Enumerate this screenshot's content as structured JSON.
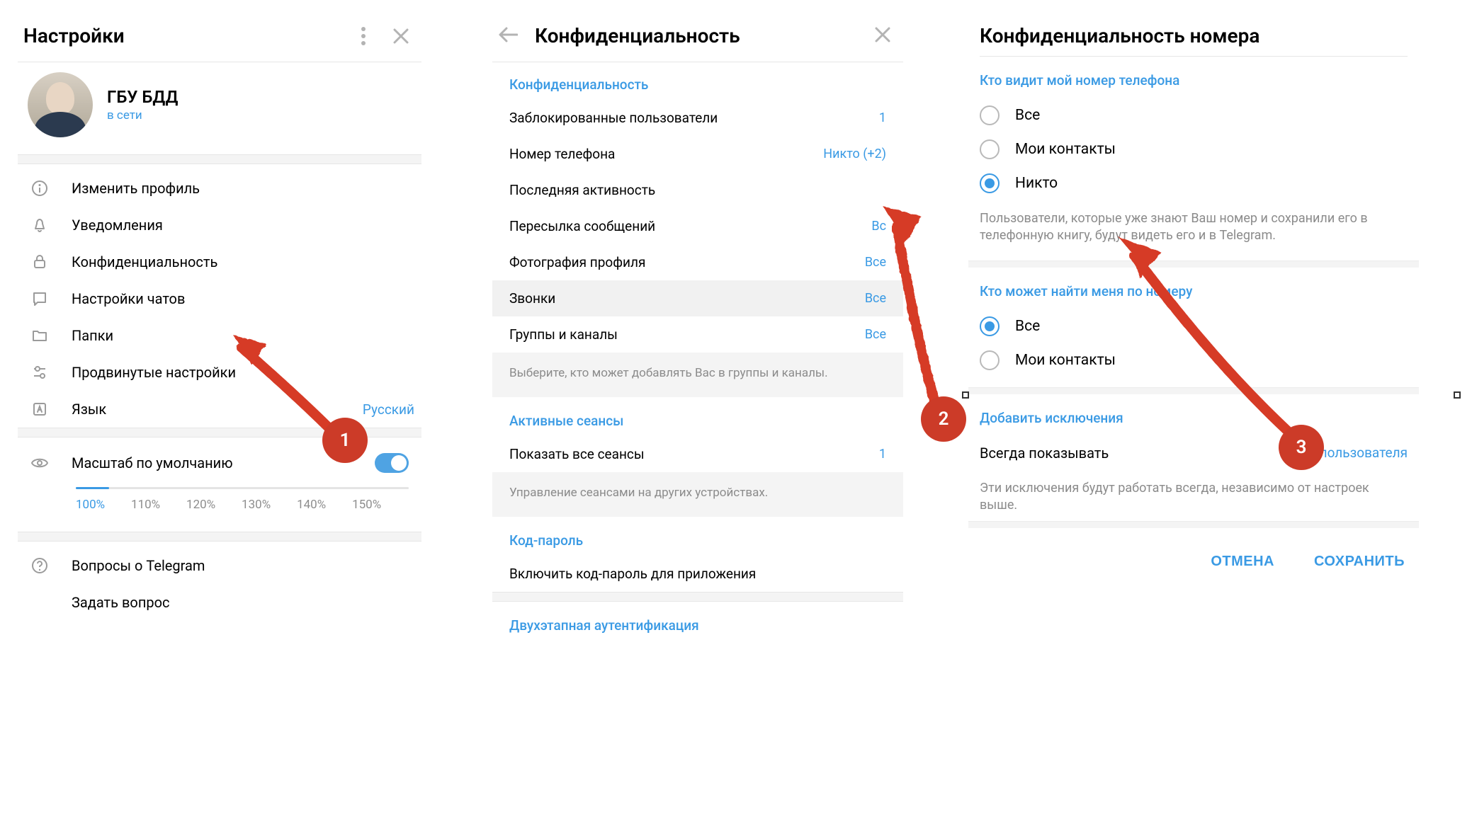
{
  "panel1": {
    "title": "Настройки",
    "profile": {
      "name": "ГБУ БДД",
      "status": "в сети"
    },
    "menu": [
      {
        "key": "edit-profile",
        "label": "Изменить профиль"
      },
      {
        "key": "notifications",
        "label": "Уведомления"
      },
      {
        "key": "privacy",
        "label": "Конфиденциальность"
      },
      {
        "key": "chat-settings",
        "label": "Настройки чатов"
      },
      {
        "key": "folders",
        "label": "Папки"
      },
      {
        "key": "advanced",
        "label": "Продвинутые настройки"
      },
      {
        "key": "language",
        "label": "Язык",
        "value": "Русский"
      }
    ],
    "zoom": {
      "label": "Масштаб по умолчанию",
      "levels": [
        "100%",
        "110%",
        "120%",
        "130%",
        "140%",
        "150%"
      ],
      "active_index": 0,
      "toggle_on": true
    },
    "footer": [
      {
        "key": "faq",
        "label": "Вопросы о Telegram"
      },
      {
        "key": "ask",
        "label": "Задать вопрос"
      }
    ]
  },
  "panel2": {
    "title": "Конфиденциальность",
    "sections": {
      "privacy_label": "Конфиденциальность",
      "rows": [
        {
          "label": "Заблокированные пользователи",
          "value": "1"
        },
        {
          "label": "Номер телефона",
          "value": "Никто (+2)"
        },
        {
          "label": "Последняя активность",
          "value": ""
        },
        {
          "label": "Пересылка сообщений",
          "value": "Вс"
        },
        {
          "label": "Фотография профиля",
          "value": "Все"
        },
        {
          "label": "Звонки",
          "value": "Все",
          "hl": true
        },
        {
          "label": "Группы и каналы",
          "value": "Все"
        }
      ],
      "groups_note": "Выберите, кто может добавлять Вас в группы и каналы.",
      "sessions_label": "Активные сеансы",
      "sessions_row": {
        "label": "Показать все сеансы",
        "value": "1"
      },
      "sessions_note": "Управление сеансами на других устройствах.",
      "passcode_label": "Код-пароль",
      "passcode_row": "Включить код-пароль для приложения",
      "twofa_label": "Двухэтапная аутентификация"
    }
  },
  "panel3": {
    "title": "Конфиденциальность номера",
    "who_sees_label": "Кто видит мой номер телефона",
    "who_sees": [
      {
        "label": "Все",
        "checked": false
      },
      {
        "label": "Мои контакты",
        "checked": false
      },
      {
        "label": "Никто",
        "checked": true
      }
    ],
    "who_sees_note": "Пользователи, которые уже знают Ваш номер и сохранили его в телефонную книгу, будут видеть его и в Telegram.",
    "who_finds_label": "Кто может найти меня по номеру",
    "who_finds": [
      {
        "label": "Все",
        "checked": true
      },
      {
        "label": "Мои контакты",
        "checked": false
      }
    ],
    "exceptions_label": "Добавить исключения",
    "exceptions_row": {
      "label": "Всегда показывать",
      "value": "2 пользователя"
    },
    "exceptions_note": "Эти исключения будут работать всегда, независимо от настроек выше.",
    "buttons": {
      "cancel": "ОТМЕНА",
      "save": "СОХРАНИТЬ"
    }
  },
  "badges": {
    "1": "1",
    "2": "2",
    "3": "3"
  }
}
